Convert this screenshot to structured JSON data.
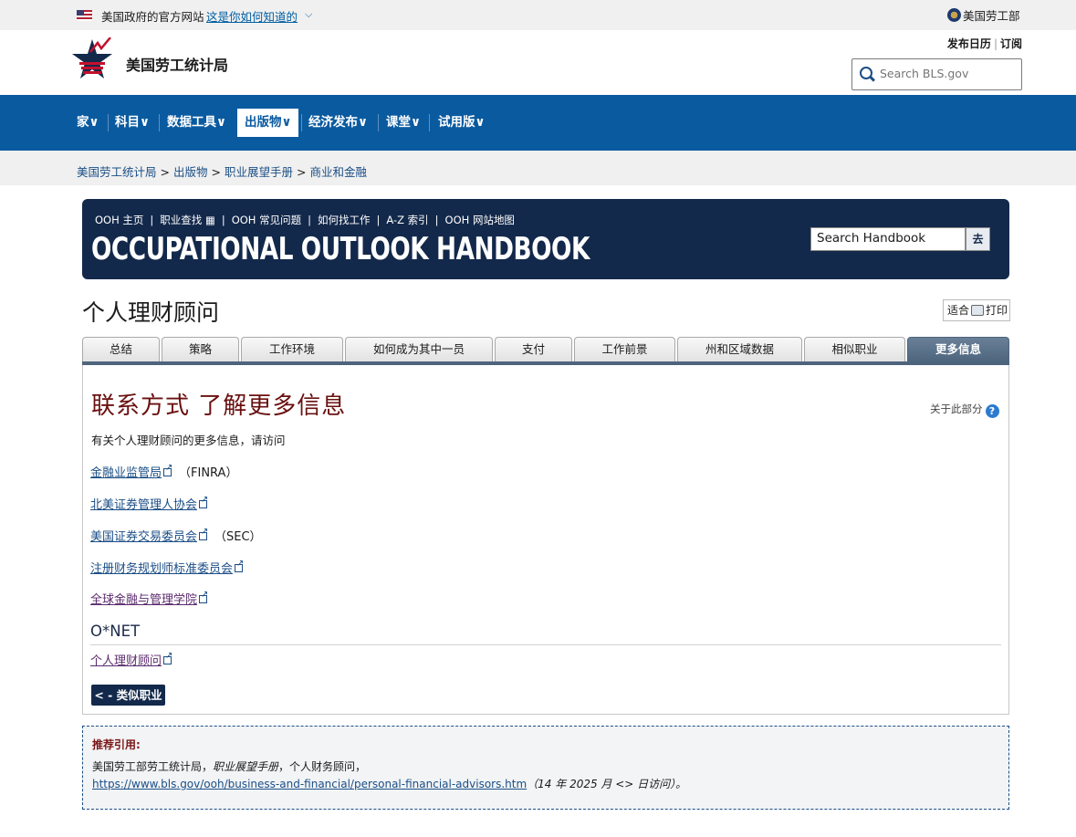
{
  "gov_banner": {
    "official_text": "美国政府的官方网站",
    "how_link": "这是你如何知道的",
    "dol": "美国劳工部"
  },
  "header": {
    "site_title": "美国劳工统计局",
    "release_calendar": "发布日历",
    "subscribe": "订阅",
    "search_placeholder": "Search BLS.gov"
  },
  "nav": {
    "items": [
      "家",
      "科目",
      "数据工具",
      "出版物",
      "经济发布",
      "课堂",
      "试用版"
    ],
    "active": "出版物"
  },
  "breadcrumb": [
    "美国劳工统计局",
    "出版物",
    "职业展望手册",
    "商业和金融"
  ],
  "ooh": {
    "links": [
      "OOH 主页",
      "职业查找",
      "OOH 常见问题",
      "如何找工作",
      "A-Z 索引",
      "OOH 网站地图"
    ],
    "title": "OCCUPATIONAL OUTLOOK HANDBOOK",
    "search_value": "Search Handbook",
    "go": "去"
  },
  "page": {
    "title": "个人理财顾问",
    "print_prefix": "适合",
    "print_suffix": "打印"
  },
  "tabs": [
    "总结",
    "策略",
    "工作环境",
    "如何成为其中一员",
    "支付",
    "工作前景",
    "州和区域数据",
    "相似职业",
    "更多信息"
  ],
  "active_tab": "更多信息",
  "content": {
    "section_title": "联系方式 了解更多信息",
    "about_section": "关于此部分",
    "intro": "有关个人理财顾问的更多信息，请访问",
    "resources": [
      {
        "name": "金融业监管局",
        "abbr": "（FINRA）"
      },
      {
        "name": "北美证券管理人协会",
        "abbr": ""
      },
      {
        "name": "美国证券交易委员会",
        "abbr": "（SEC）"
      },
      {
        "name": "注册财务规划师标准委员会",
        "abbr": ""
      },
      {
        "name": "全球金融与管理学院",
        "abbr": ""
      }
    ],
    "onet_title": "O*NET",
    "onet_link": "个人理财顾问",
    "back_button": "< - 类似职业"
  },
  "citation": {
    "heading": "推荐引用:",
    "line1_prefix": "美国劳工部劳工统计局，",
    "line1_italic": "职业展望手册",
    "line1_suffix": "，个人财务顾问，",
    "url": "https://www.bls.gov/ooh/business-and-financial/personal-financial-advisors.htm",
    "accessed": "（14 年 2025 月 <> 日访问）。"
  },
  "colors": {
    "nav_blue": "#0a5aa0",
    "ooh_navy": "#13294b",
    "section_title_red": "#6a1010",
    "link_blue": "#1b4e86"
  }
}
